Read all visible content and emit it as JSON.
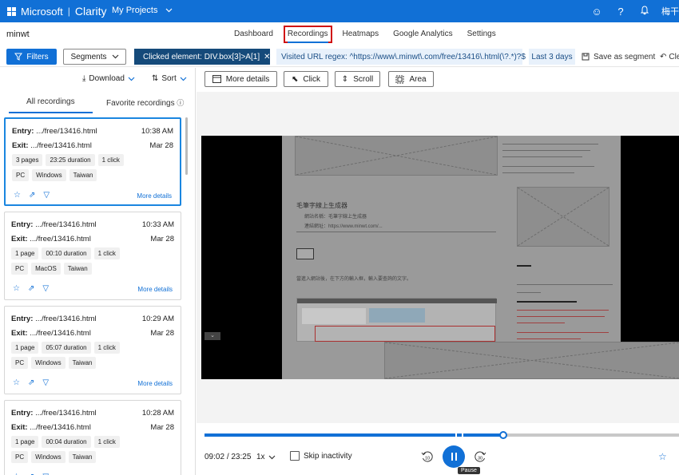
{
  "topbar": {
    "brand": "Microsoft",
    "product": "Clarity",
    "projects_label": "My Projects",
    "user": "梅干"
  },
  "nav": {
    "site": "minwt",
    "tabs": [
      {
        "label": "Dashboard"
      },
      {
        "label": "Recordings",
        "active": true
      },
      {
        "label": "Heatmaps"
      },
      {
        "label": "Google Analytics"
      },
      {
        "label": "Settings"
      }
    ]
  },
  "filters": {
    "filters_label": "Filters",
    "segments_label": "Segments",
    "clicked_element": "Clicked element: DIV.box[3]>A[1]",
    "url_regex": "Visited URL regex: ^https://www\\.minwt\\.com/free/13416\\.html(\\?.*)?$",
    "date_range": "Last 3 days",
    "save_segment": "Save as segment",
    "clear": "Cle"
  },
  "list": {
    "download": "Download",
    "sort": "Sort",
    "tab_all": "All recordings",
    "tab_favorite": "Favorite recordings",
    "entry_prefix": "Entry:",
    "exit_prefix": "Exit:",
    "more_details": "More details",
    "recordings": [
      {
        "entry": ".../free/13416.html",
        "exit": ".../free/13416.html",
        "time": "10:38 AM",
        "date": "Mar 28",
        "pages": "3 pages",
        "duration": "23:25 duration",
        "clicks": "1 click",
        "device": "PC",
        "os": "Windows",
        "country": "Taiwan",
        "selected": true
      },
      {
        "entry": ".../free/13416.html",
        "exit": ".../free/13416.html",
        "time": "10:33 AM",
        "date": "Mar 28",
        "pages": "1 page",
        "duration": "00:10 duration",
        "clicks": "1 click",
        "device": "PC",
        "os": "MacOS",
        "country": "Taiwan"
      },
      {
        "entry": ".../free/13416.html",
        "exit": ".../free/13416.html",
        "time": "10:29 AM",
        "date": "Mar 28",
        "pages": "1 page",
        "duration": "05:07 duration",
        "clicks": "1 click",
        "device": "PC",
        "os": "Windows",
        "country": "Taiwan"
      },
      {
        "entry": ".../free/13416.html",
        "exit": ".../free/13416.html",
        "time": "10:28 AM",
        "date": "Mar 28",
        "pages": "1 page",
        "duration": "00:04 duration",
        "clicks": "1 click",
        "device": "PC",
        "os": "Windows",
        "country": "Taiwan"
      }
    ]
  },
  "player": {
    "more_details": "More details",
    "click": "Click",
    "scroll": "Scroll",
    "area": "Area",
    "page_heading": "毛筆字線上生成器",
    "page_label1": "網站名稱：毛筆字線上生成器",
    "page_label2": "連結網址：https://www.minwt.com/...",
    "page_text": "當進入網站後，在下方的輸入框，輸入要查詢的文字。",
    "progress_fraction": 0.629,
    "current_time": "09:02",
    "total_time": "23:25",
    "time_separator": "/",
    "speed": "1x",
    "skip_inactivity": "Skip inactivity",
    "rewind_seconds": "10",
    "forward_seconds": "30",
    "pause_tooltip": "Pause"
  }
}
